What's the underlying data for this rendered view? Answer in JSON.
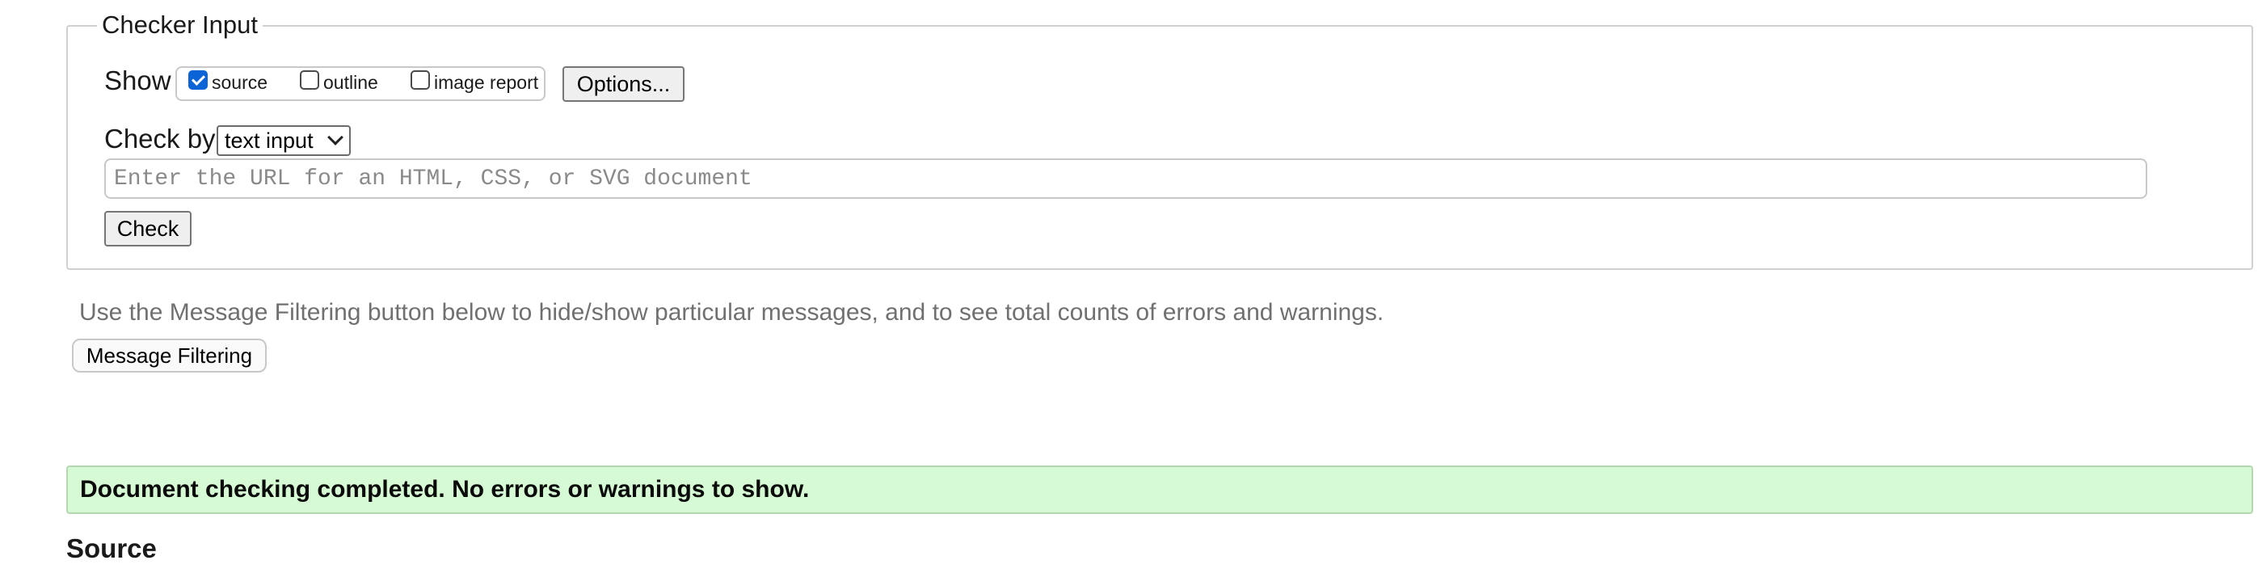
{
  "checker_input": {
    "legend": "Checker Input",
    "show_label": "Show",
    "show_options": [
      {
        "label": "source",
        "checked": true
      },
      {
        "label": "outline",
        "checked": false
      },
      {
        "label": "image report",
        "checked": false
      }
    ],
    "options_button": "Options...",
    "check_by_label": "Check by",
    "check_by_value": "text input",
    "url_placeholder": "Enter the URL for an HTML, CSS, or SVG document",
    "url_value": "",
    "check_button": "Check"
  },
  "filtering": {
    "hint": "Use the Message Filtering button below to hide/show particular messages, and to see total counts of errors and warnings.",
    "button": "Message Filtering"
  },
  "result": {
    "message": "Document checking completed. No errors or warnings to show."
  },
  "source": {
    "heading": "Source"
  },
  "colors": {
    "success_bg": "#d6fad3",
    "checkbox_accent": "#0a64d6"
  },
  "icons": {
    "checkbox_checked": "checkmark-icon",
    "select_arrow": "chevron-down-icon"
  }
}
